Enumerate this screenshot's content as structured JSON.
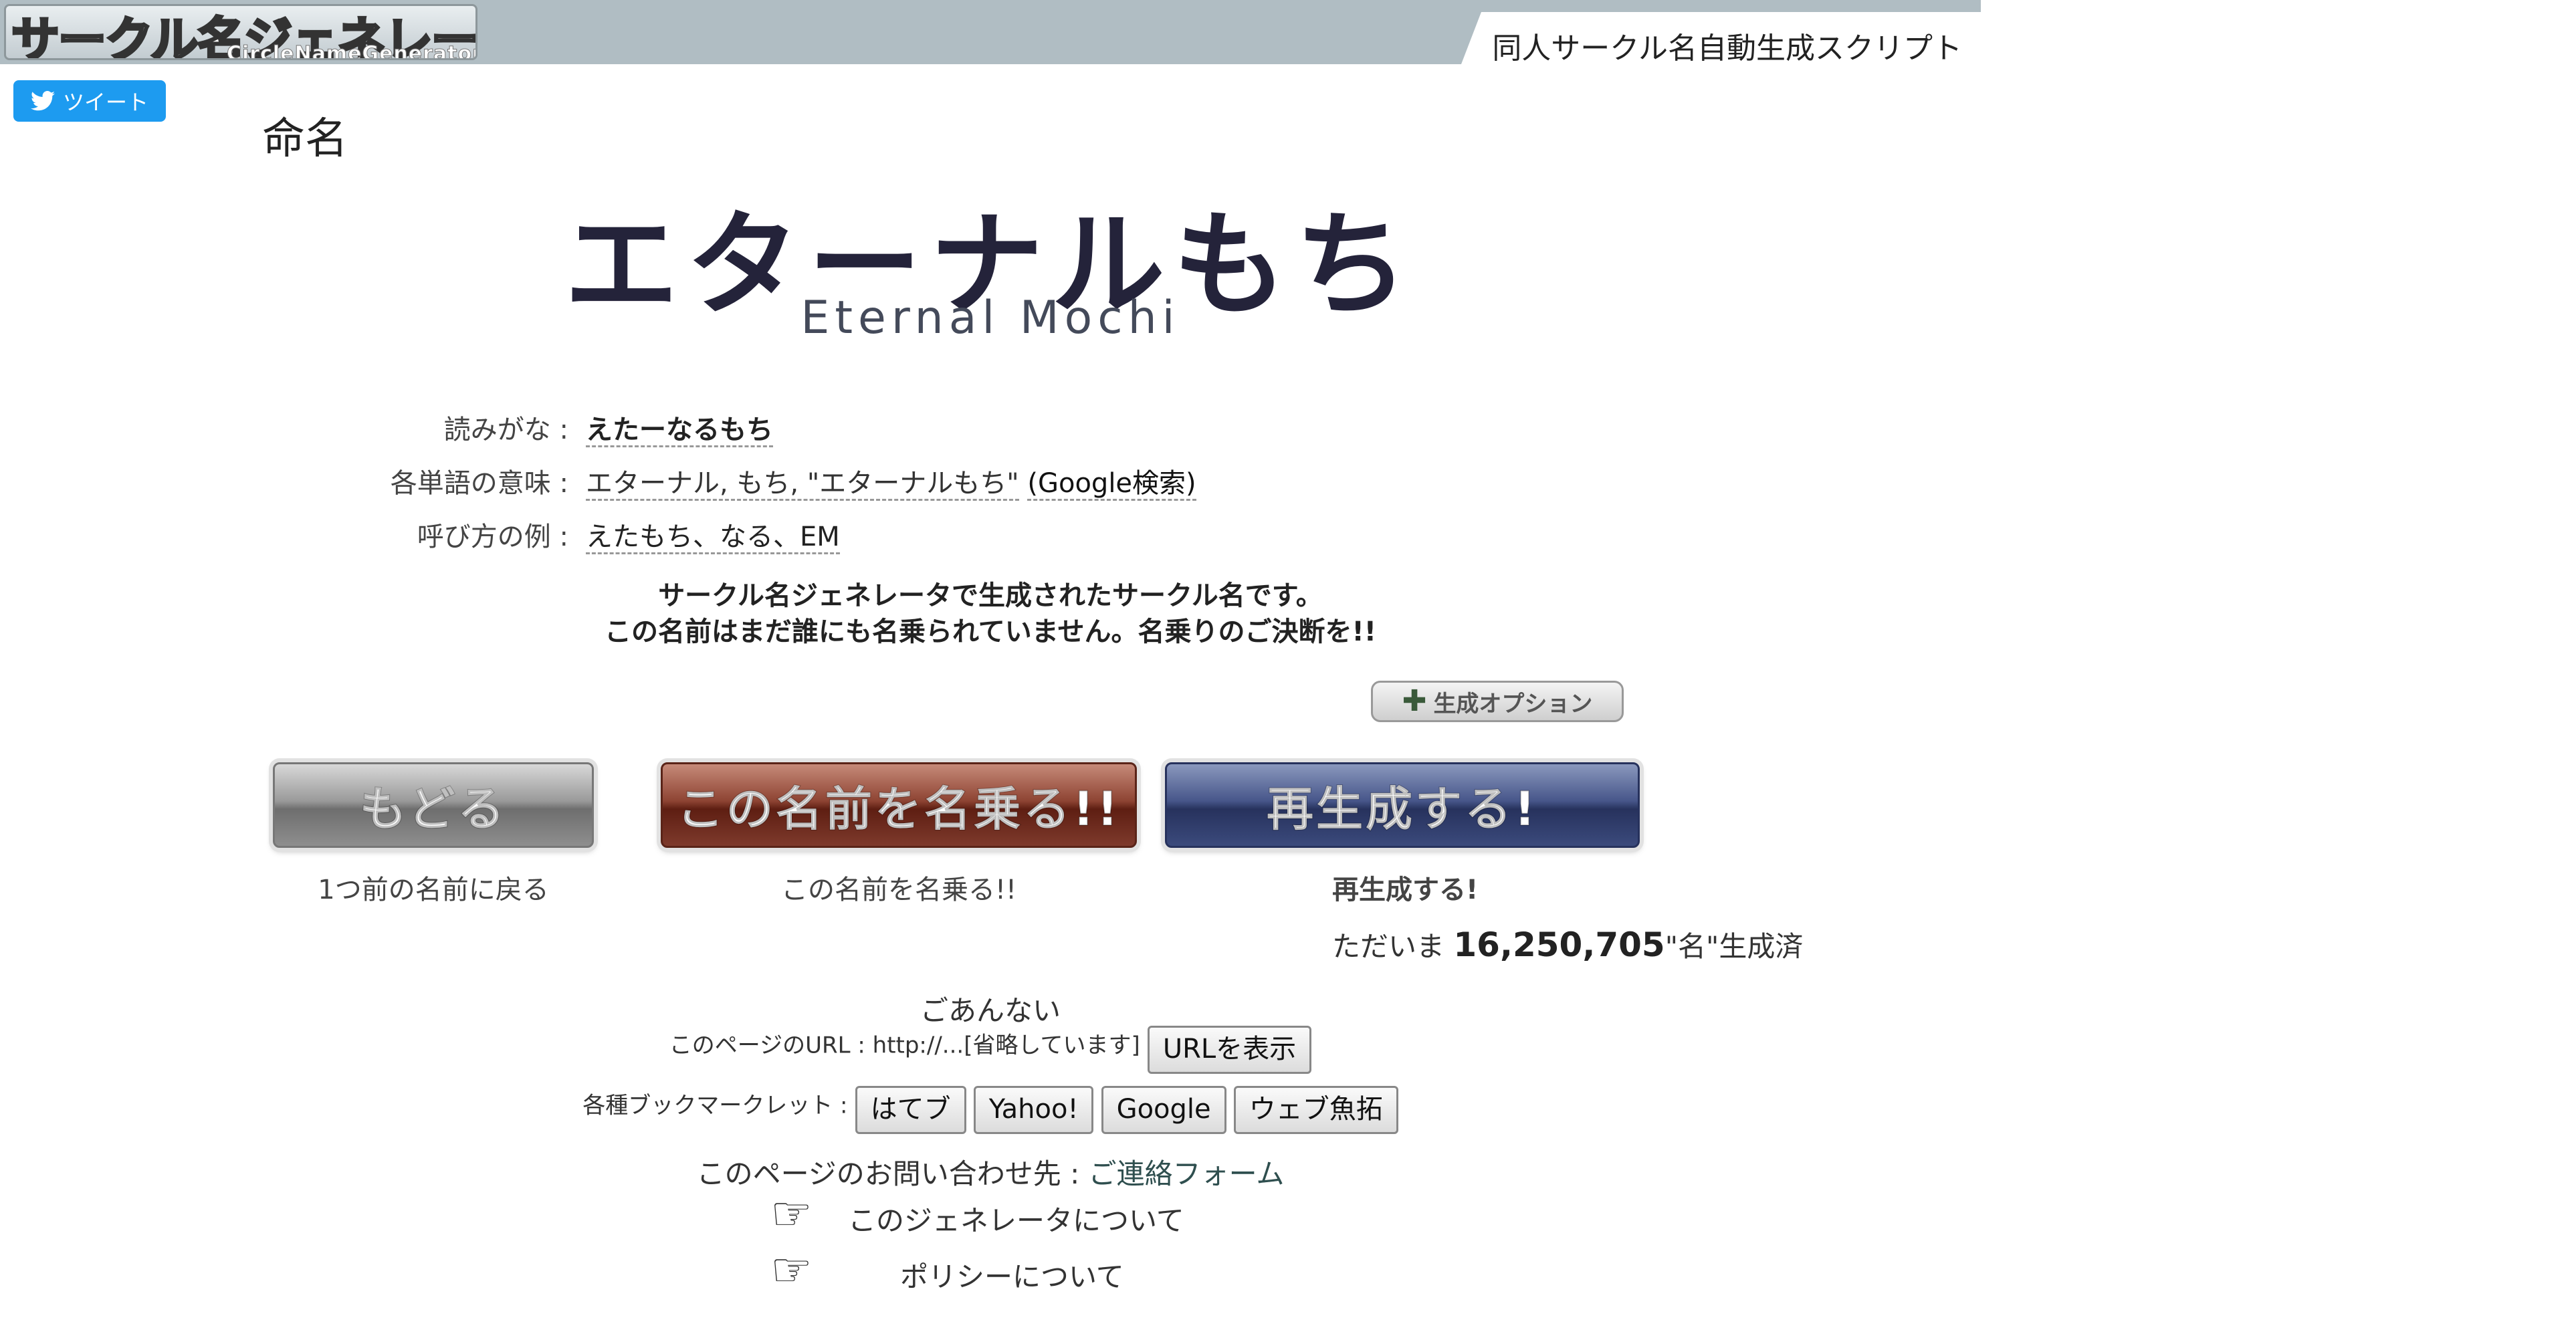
{
  "header": {
    "logo_text": "サークル名ジェネレータ",
    "logo_sub": "CircleNameGenerator",
    "tagline": "同人サークル名自動生成スクリプト"
  },
  "tweet": {
    "label": "ツイート"
  },
  "page_title": "命名",
  "result": {
    "name_jp": "エターナルもち",
    "name_en": "Eternal Mochi"
  },
  "details": {
    "reading_label": "読みがな :",
    "reading_value": "えたーなるもち",
    "meaning_label": "各単語の意味 :",
    "meaning_value": "エターナル, もち, \"エターナルもち\"",
    "meaning_search": "(Google検索)",
    "nickname_label": "呼び方の例 :",
    "nickname_value": "えたもち、なる、EM"
  },
  "notice": {
    "line1": "サークル名ジェネレータで生成されたサークル名です。",
    "line2": "この名前はまだ誰にも名乗られていません。名乗りのご決断を!!"
  },
  "options_button": "生成オプション",
  "buttons": {
    "back": "もどる",
    "back_caption": "1つ前の名前に戻る",
    "claim": "この名前を名乗る!!",
    "claim_caption": "この名前を名乗る!!",
    "regen": "再生成する!",
    "regen_caption": "再生成する!"
  },
  "counter": {
    "prefix": "ただいま",
    "count": "16,250,705",
    "suffix": "\"名\"生成済"
  },
  "guide": {
    "title": "ごあんない",
    "url_label": "このページのURL : http://...[省略しています]",
    "url_button": "URLを表示",
    "bookmarklet_label": "各種ブックマークレット :",
    "bookmarklets": [
      "はてブ",
      "Yahoo!",
      "Google",
      "ウェブ魚拓"
    ],
    "contact_label": "このページのお問い合わせ先 :",
    "contact_link": "ご連絡フォーム",
    "about_link": "このジェネレータについて",
    "policy_link": "ポリシーについて"
  },
  "colors": {
    "header_bg": "#b0bdc3",
    "tweet_blue": "#1d9bf0",
    "claim_red": "#8e4433",
    "regen_blue": "#47568a",
    "back_gray": "#9a9a9a"
  }
}
